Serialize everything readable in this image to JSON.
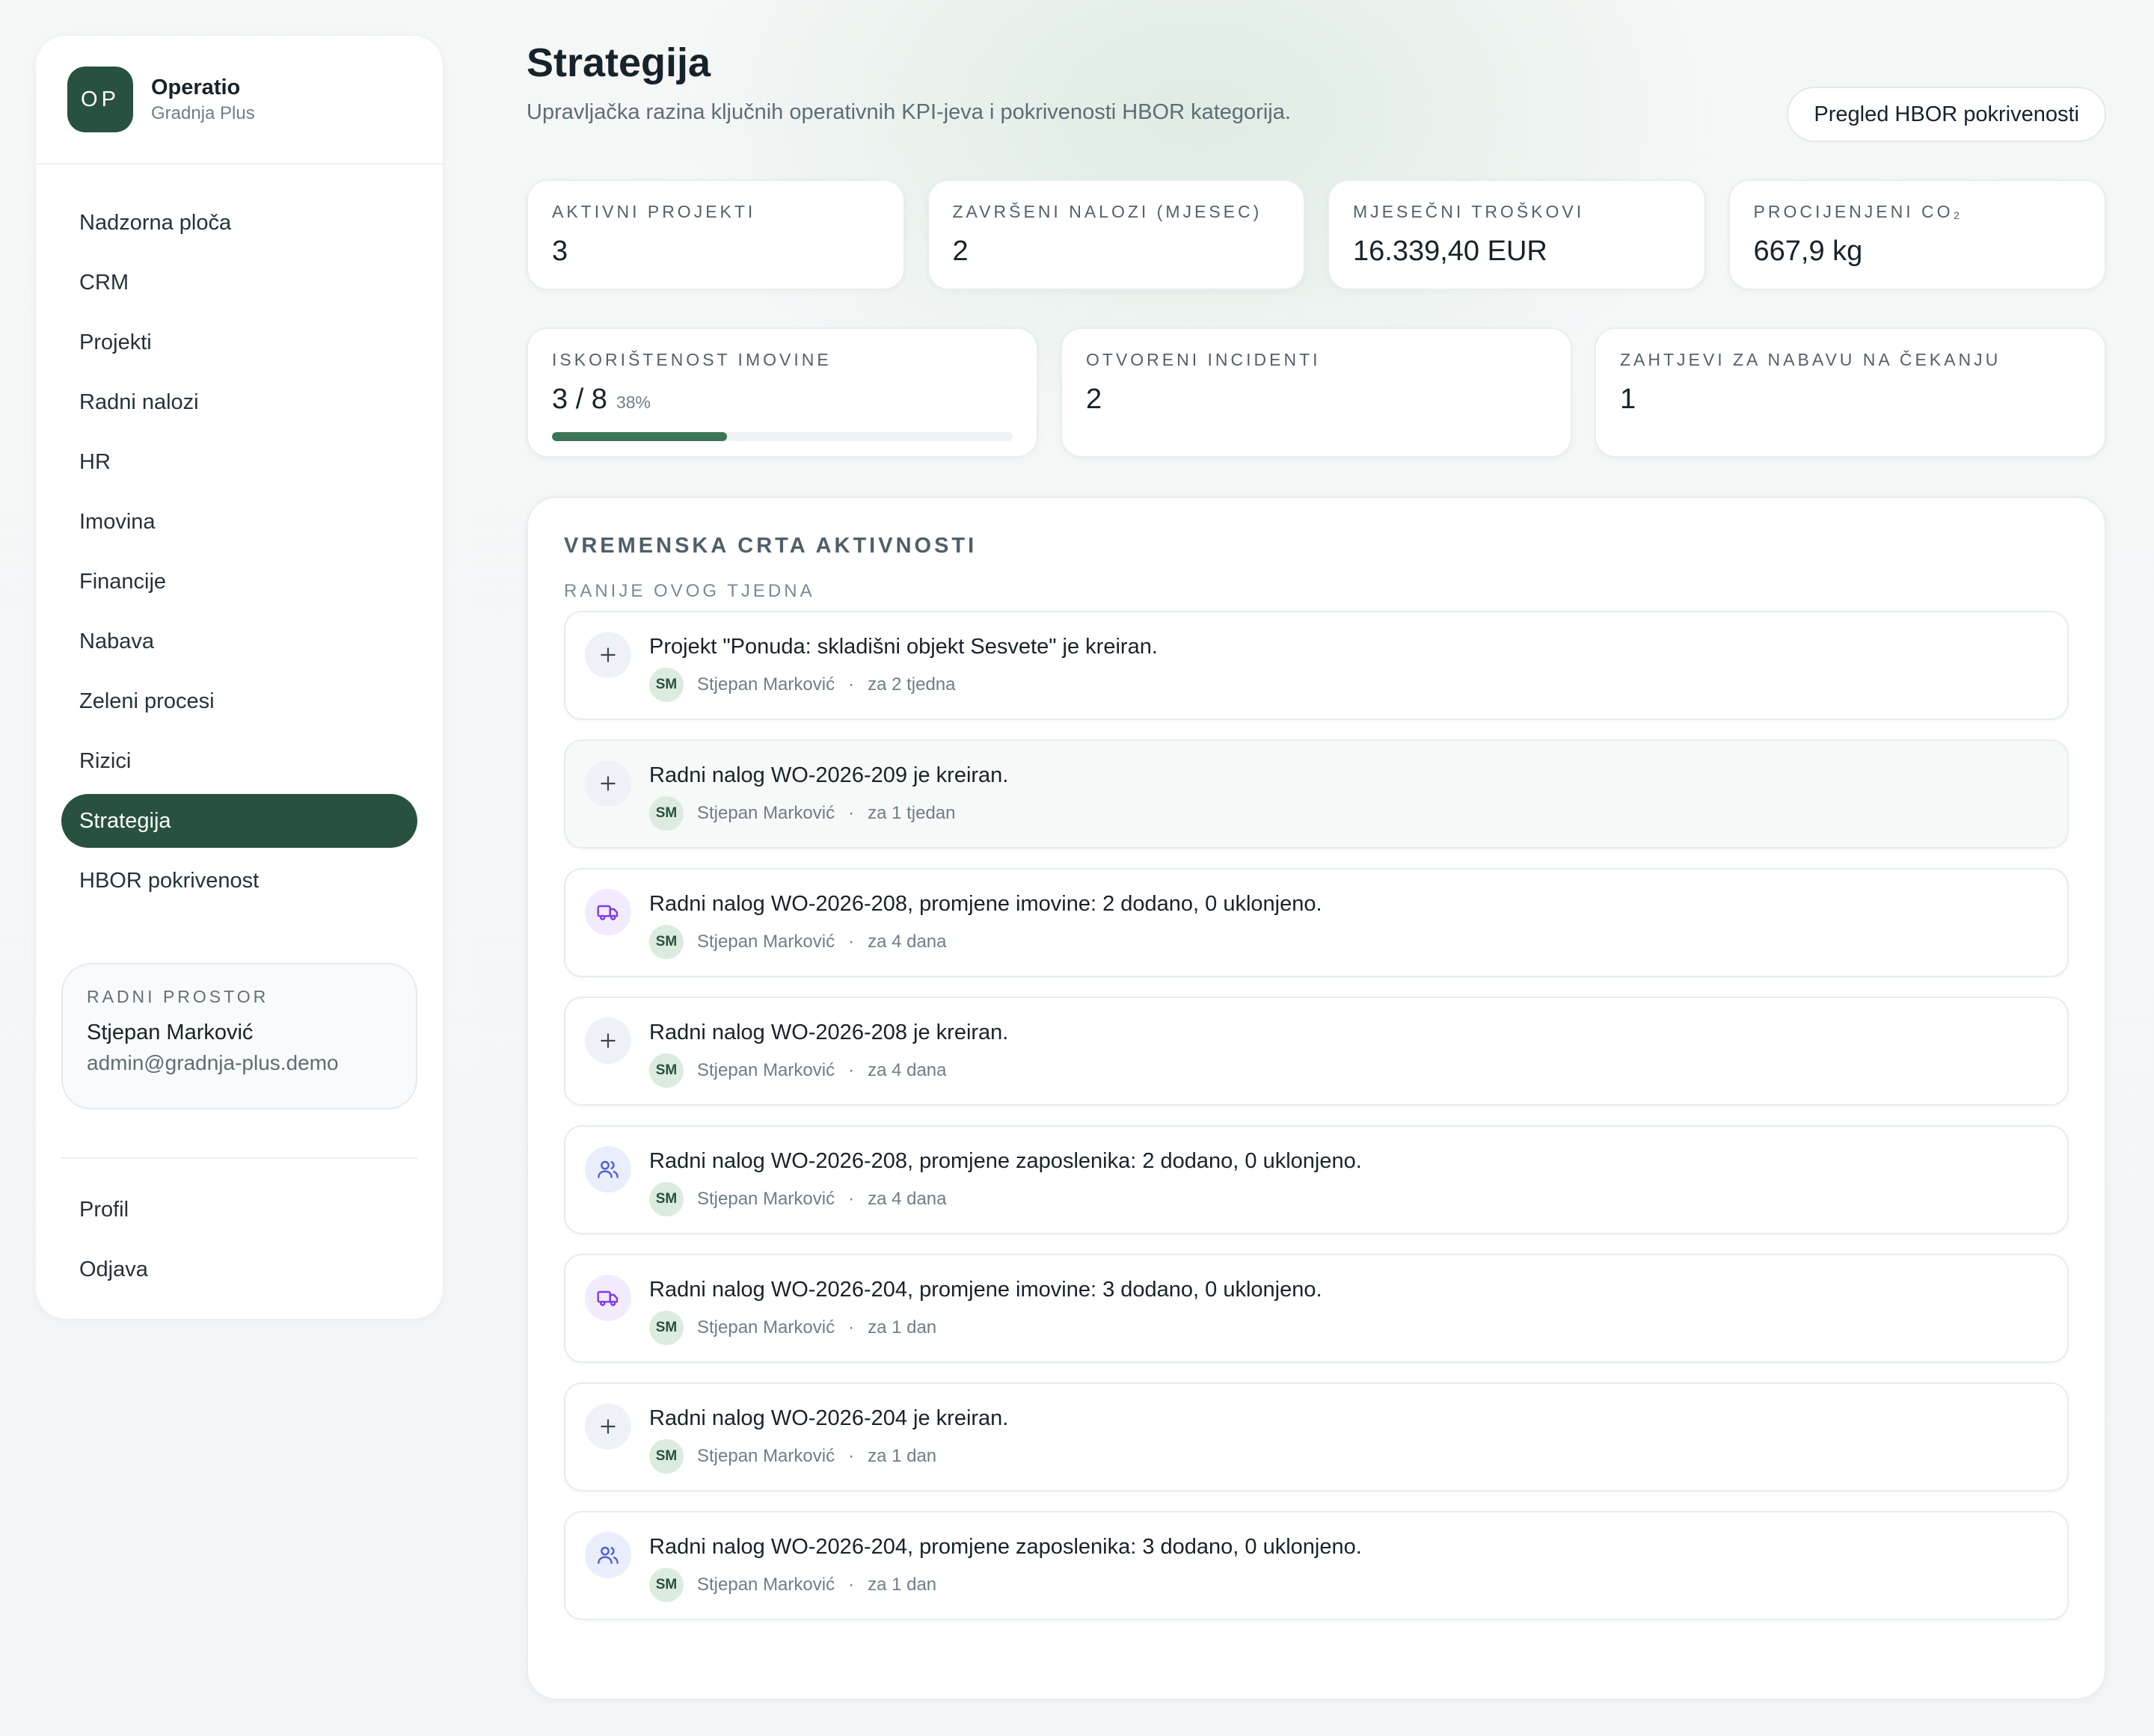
{
  "brand": {
    "initials": "OP",
    "name": "Operatio",
    "subtitle": "Gradnja Plus"
  },
  "nav": {
    "items": [
      {
        "label": "Nadzorna ploča",
        "id": "nadzorna-ploca"
      },
      {
        "label": "CRM",
        "id": "crm"
      },
      {
        "label": "Projekti",
        "id": "projekti"
      },
      {
        "label": "Radni nalozi",
        "id": "radni-nalozi"
      },
      {
        "label": "HR",
        "id": "hr"
      },
      {
        "label": "Imovina",
        "id": "imovina"
      },
      {
        "label": "Financije",
        "id": "financije"
      },
      {
        "label": "Nabava",
        "id": "nabava"
      },
      {
        "label": "Zeleni procesi",
        "id": "zeleni-procesi"
      },
      {
        "label": "Rizici",
        "id": "rizici"
      },
      {
        "label": "Strategija",
        "id": "strategija",
        "active": true
      },
      {
        "label": "HBOR pokrivenost",
        "id": "hbor-pokrivenost"
      }
    ]
  },
  "workspace": {
    "label": "Radni prostor",
    "name": "Stjepan Marković",
    "email": "admin@gradnja-plus.demo"
  },
  "bottom_nav": {
    "profile": "Profil",
    "logout": "Odjava"
  },
  "header": {
    "title": "Strategija",
    "subtitle": "Upravljačka razina ključnih operativnih KPI-jeva i pokrivenosti HBOR kategorija.",
    "hbor_button": "Pregled HBOR pokrivenosti"
  },
  "kpis_row1": [
    {
      "label": "Aktivni projekti",
      "value": "3"
    },
    {
      "label": "Završeni nalozi (mjesec)",
      "value": "2"
    },
    {
      "label": "Mjesečni troškovi",
      "value": "16.339,40 EUR"
    },
    {
      "label": "Procijenjeni CO₂",
      "value": "667,9 kg"
    }
  ],
  "kpis_row2": {
    "asset_usage": {
      "label": "Iskorištenost imovine",
      "value": "3 / 8",
      "percent": "38%",
      "fill": 0.38
    },
    "incidents": {
      "label": "Otvoreni incidenti",
      "value": "2"
    },
    "procurement": {
      "label": "Zahtjevi za nabavu na čekanju",
      "value": "1"
    }
  },
  "timeline": {
    "title": "Vremenska crta aktivnosti",
    "group": "Ranije ovog tjedna",
    "colors": {
      "purple": "#7c3aed",
      "blue": "#4f5fd6",
      "plus": "#3b4650"
    },
    "items": [
      {
        "icon": "plus-icon",
        "text": "Projekt \"Ponuda: skladišni objekt Sesvete\" je kreiran.",
        "initials": "SM",
        "author": "Stjepan Marković",
        "time": "za 2 tjedna"
      },
      {
        "icon": "plus-icon",
        "text": "Radni nalog WO-2026-209 je kreiran.",
        "initials": "SM",
        "author": "Stjepan Marković",
        "time": "za 1 tjedan"
      },
      {
        "icon": "truck-icon",
        "text": "Radni nalog WO-2026-208, promjene imovine: 2 dodano, 0 uklonjeno.",
        "initials": "SM",
        "author": "Stjepan Marković",
        "time": "za 4 dana"
      },
      {
        "icon": "plus-icon",
        "text": "Radni nalog WO-2026-208 je kreiran.",
        "initials": "SM",
        "author": "Stjepan Marković",
        "time": "za 4 dana"
      },
      {
        "icon": "users-icon",
        "text": "Radni nalog WO-2026-208, promjene zaposlenika: 2 dodano, 0 uklonjeno.",
        "initials": "SM",
        "author": "Stjepan Marković",
        "time": "za 4 dana"
      },
      {
        "icon": "truck-icon",
        "text": "Radni nalog WO-2026-204, promjene imovine: 3 dodano, 0 uklonjeno.",
        "initials": "SM",
        "author": "Stjepan Marković",
        "time": "za 1 dan"
      },
      {
        "icon": "plus-icon",
        "text": "Radni nalog WO-2026-204 je kreiran.",
        "initials": "SM",
        "author": "Stjepan Marković",
        "time": "za 1 dan"
      },
      {
        "icon": "users-icon",
        "text": "Radni nalog WO-2026-204, promjene zaposlenika: 3 dodano, 0 uklonjeno.",
        "initials": "SM",
        "author": "Stjepan Marković",
        "time": "za 1 dan"
      }
    ]
  }
}
